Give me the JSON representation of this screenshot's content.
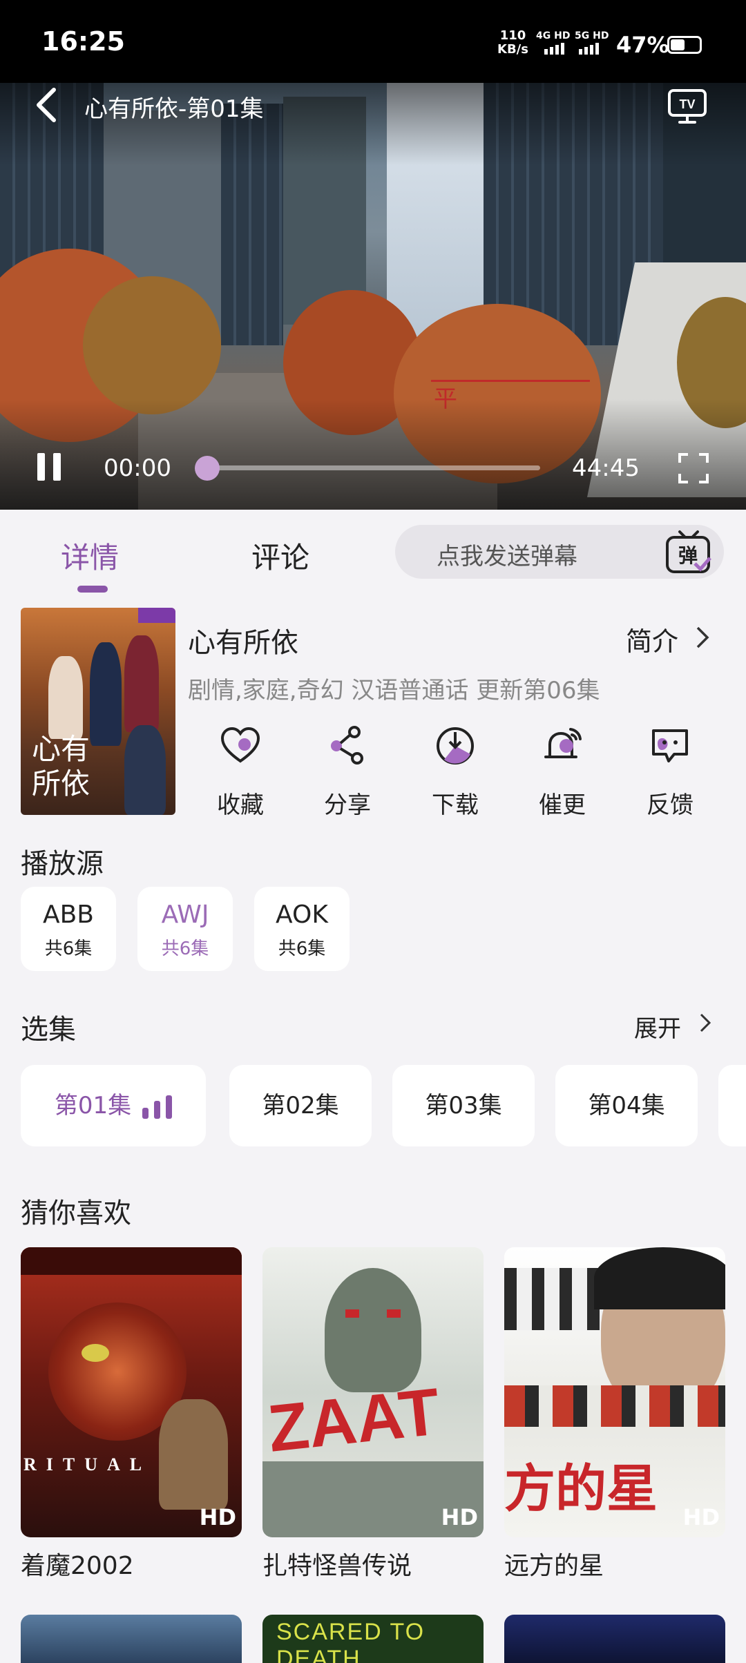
{
  "status_bar": {
    "time": "16:25",
    "net_speed": "110",
    "net_unit": "KB/s",
    "sim1": "4G HD",
    "sim2": "5G HD",
    "battery": "47%"
  },
  "player": {
    "title": "心有所依-第01集",
    "current_time": "00:00",
    "total_time": "44:45",
    "progress_fraction": 0.0,
    "subtitle_glyph": "平"
  },
  "tabs": {
    "details": "详情",
    "comments": "评论",
    "danmu_placeholder": "点我发送弹幕",
    "danmu_icon": "弹"
  },
  "show": {
    "title": "心有所依",
    "intro_label": "简介",
    "meta": "剧情,家庭,奇幻 汉语普通话 更新第06集",
    "poster_title_line1": "心有",
    "poster_title_line2": "所依",
    "actions": [
      {
        "label": "收藏",
        "icon": "heart-icon"
      },
      {
        "label": "分享",
        "icon": "share-icon"
      },
      {
        "label": "下载",
        "icon": "download-icon"
      },
      {
        "label": "催更",
        "icon": "bell-icon"
      },
      {
        "label": "反馈",
        "icon": "feedback-icon"
      }
    ]
  },
  "sources": {
    "heading": "播放源",
    "items": [
      {
        "name": "ABB",
        "count": "共6集"
      },
      {
        "name": "AWJ",
        "count": "共6集"
      },
      {
        "name": "AOK",
        "count": "共6集"
      }
    ]
  },
  "episodes": {
    "heading": "选集",
    "expand_label": "展开",
    "items": [
      "第01集",
      "第02集",
      "第03集",
      "第04集"
    ]
  },
  "recommend": {
    "heading": "猜你喜欢",
    "badge": "HD",
    "items": [
      {
        "title": "着魔2002",
        "art_text": "RITUAL"
      },
      {
        "title": "扎特怪兽传说",
        "art_text": "ZAAT"
      },
      {
        "title": "远方的星",
        "art_text": "方的星"
      }
    ],
    "row2_art_text": "SCARED TO DEATH"
  },
  "colors": {
    "accent": "#8a55a8",
    "accent_light": "#c9a3d6",
    "background": "#f4f3f6"
  }
}
